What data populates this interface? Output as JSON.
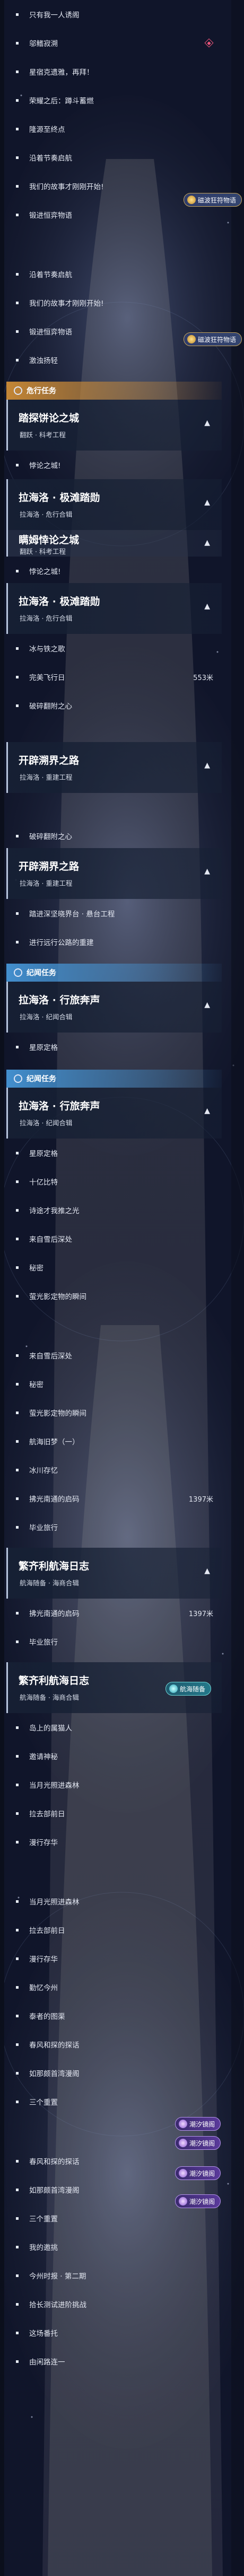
{
  "badges": {
    "gold": "磁波狂符物语",
    "cyan": "航海随备",
    "purple": "潮汐镜阁"
  },
  "labels": {
    "r_ytrjp": "只有我一人诱阁",
    "r_sfrm": "邬鳍寂溯",
    "r_xgmdl": "星宿克遗雅，再拜！",
    "r_rjzh": "荣耀之后：蹲斗蓄燃",
    "r_tyzd": "隆源至终点",
    "r_yhjq": "沿着节奏启航",
    "r_wmgs": "我们的故事才刚刚开始!",
    "r_sxbx": "锻进恒弈物语",
    "r_ltxg": "激浊扬轻",
    "cat_wx": "危行任务",
    "cat_jl": "纪闻任务",
    "h1_t": "踏探饼论之城",
    "h1_s": "翻跃 · 科考工程",
    "h2_t": "拉海洛 · 极滩踏勋",
    "h2_s": "拉海洛 · 危行合辑",
    "h2d_t": "瞒姆悻论之城",
    "h2d_s": "翻跃 · 科考工程",
    "h3_t": "拉海洛 · 极滩踏勋",
    "h3_s": "拉海洛 · 危行合辑",
    "h4_t": "开辟溯界之路",
    "h4_s": "拉海洛 · 重建工程",
    "h5_t": "开辟溯界之路",
    "h5_s": "拉海洛 · 重建工程",
    "h6_t": "拉海洛 · 行旅奔声",
    "h6_s": "拉海洛 · 纪闻合辑",
    "h7_t": "拉海洛 · 行旅奔声",
    "h7_s": "拉海洛 · 纪闻合辑",
    "h8_t": "繁齐利航海日志",
    "h8_s": "航海随备 · 海商合辑",
    "h9_t": "繁齐利航海日志",
    "h9_s": "航海随备 · 海商合辑",
    "r_xyz": "悖论之城!",
    "r_bydq": "冰与铁之歌",
    "r_wm": "完美飞行日",
    "r_wm_val": "553米",
    "r_xyzx": "破碎翻附之心",
    "r_xyzx2": "破碎翻附之心",
    "r_jxsx": "踏进深坚晓界台 · 悬台工程",
    "r_jxyx": "进行远行公路的重建",
    "r_xhzy": "星原定格",
    "r_xhzy2": "星原定格",
    "r_sblt": "十亿比特",
    "r_hbg": "诗途才我推之光",
    "r_lzhsd": "来自雪后深处",
    "r_mm": "秘密",
    "r_ygdm": "萤光影定物的瞬间",
    "r_lzhsd2": "来自雪后深处",
    "r_mm2": "秘密",
    "r_ygdm2": "萤光影定物的瞬间",
    "r_hhsq": "航海旧梦（一）",
    "r_bcry": "冰川存忆",
    "r_sxgs": "拂光南通的启码",
    "r_sxgs_v": "1397米",
    "r_bcsy": "毕业旅行",
    "r_sxgs2": "拂光南通的启码",
    "r_sxgs2_v": "1397米",
    "r_bcsy2": "毕业旅行",
    "r_dsjm": "岛上的属猫人",
    "r_yjsl": "邀请神秘",
    "r_dy": "当月光照进森林",
    "r_hxjd": "拉去部前日",
    "r_ylzf": "漫行存华",
    "r_dy2": "当月光照进森林",
    "r_hxjd2": "拉去部前日",
    "r_ylzf2": "漫行存华",
    "r_ms": "勤忆今州",
    "r_mxjx": "泰者的图渠",
    "r_ysdz": "春风和探的探话",
    "r_zrmg": "如那颇首湾漫阁",
    "r_sggg": "三个重置",
    "r_ysdz2": "春风和探的探话",
    "r_zrmg2": "如那颇首湾漫阁",
    "r_sggg2": "三个重置",
    "r_wdlq": "我的邀挑",
    "r_jsdh": "今州时报 · 第二期",
    "r_bwcs": "拾长测试进阶挑战",
    "r_tfx": "这场番托",
    "r_qxyz": "由闲路连一"
  }
}
